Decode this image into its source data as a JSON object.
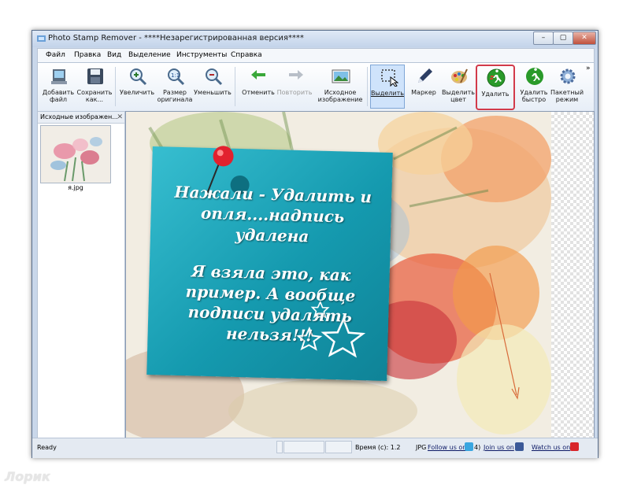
{
  "window": {
    "title": "Photo Stamp Remover - ****Незарегистрированная версия****",
    "controls": {
      "minimize": "–",
      "maximize": "▢",
      "close": "✕"
    }
  },
  "menu": [
    "Файл",
    "Правка",
    "Вид",
    "Выделение",
    "Инструменты",
    "Справка"
  ],
  "toolbar": {
    "add_file": "Добавить файл",
    "save_as": "Сохранить как...",
    "zoom_in": "Увеличить",
    "original_size": "Размер оригинала",
    "zoom_out": "Уменьшить",
    "undo": "Отменить",
    "redo": "Повторить",
    "source_image": "Исходное изображение",
    "select": "Выделить",
    "marker": "Маркер",
    "select_color": "Выделить цвет",
    "remove": "Удалить",
    "remove_fast": "Удалить быстро",
    "batch_mode": "Пакетный режим",
    "overflow": "»"
  },
  "panel": {
    "title": "Исходные изображен...",
    "close": "✕",
    "thumbnail_label": "я.jpg"
  },
  "note": {
    "line1": "Нажали - Удалить и",
    "line2": "опля....надпись",
    "line3": "удалена",
    "line4": "Я взяла это, как",
    "line5": "пример. А вообще",
    "line6": "подписи удалять",
    "line7": "нельзя!!!"
  },
  "status": {
    "ready": "Ready",
    "time": "Время (с): 1.2",
    "format": "JPG",
    "follow_twitter": "Follow us on",
    "twitter_count": "4)",
    "join_facebook": "Join us on",
    "watch_youtube": "Watch us on"
  },
  "overlay_watermark": "Лорик",
  "colors": {
    "note": "#1aa3b8",
    "remove_highlight": "#d23a4a",
    "select_active": "#cfe3fb"
  },
  "icons": {
    "add_file": "add-file-icon",
    "save": "floppy-disk-icon",
    "zoom_in": "zoom-in-icon",
    "original_size": "zoom-original-icon",
    "zoom_out": "zoom-out-icon",
    "undo": "undo-arrow-icon",
    "redo": "redo-arrow-icon",
    "source_image": "picture-icon",
    "select": "selection-rectangle-icon",
    "marker": "marker-pen-icon",
    "select_color": "palette-icon",
    "remove": "remove-runner-icon",
    "remove_fast": "fast-runner-icon",
    "batch_mode": "gear-icon"
  }
}
